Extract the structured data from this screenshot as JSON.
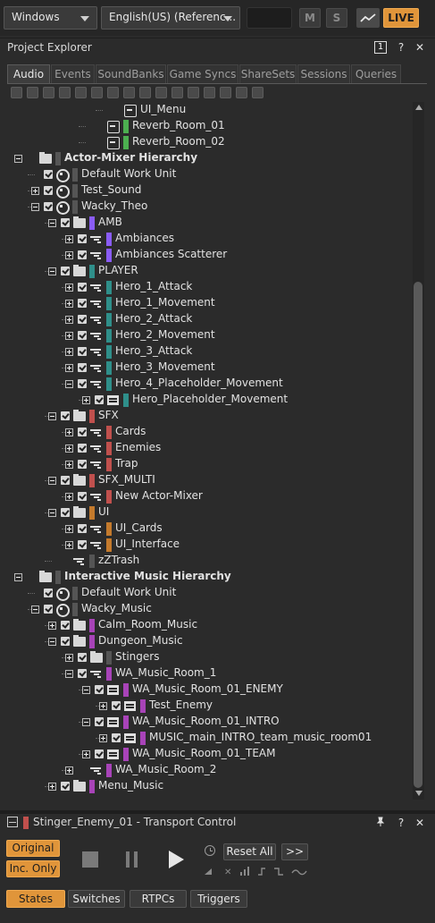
{
  "toolbar": {
    "platform": "Windows",
    "language": "English(US) (Referenc...",
    "mute": "M",
    "solo": "S",
    "live": "LIVE",
    "accent": "#e0953a"
  },
  "explorer": {
    "title": "Project Explorer",
    "badge": "1",
    "tabs": [
      "Audio",
      "Events",
      "SoundBanks",
      "Game Syncs",
      "ShareSets",
      "Sessions",
      "Queries"
    ],
    "active_tab": "Audio"
  },
  "tree": [
    {
      "label": "UI_Menu",
      "icon": "bus-icon",
      "level": 5,
      "exp": "",
      "cb": false,
      "bold": false,
      "color": ""
    },
    {
      "label": "Reverb_Room_01",
      "icon": "aux-bus-icon",
      "level": 4,
      "exp": "",
      "cb": false,
      "bold": false,
      "color": "#4caf50"
    },
    {
      "label": "Reverb_Room_02",
      "icon": "aux-bus-icon",
      "level": 4,
      "exp": "",
      "cb": false,
      "bold": false,
      "color": "#4caf50"
    },
    {
      "label": "Actor-Mixer Hierarchy",
      "icon": "folder-icon",
      "level": 0,
      "exp": "minus",
      "cb": false,
      "bold": true,
      "color": "#555555"
    },
    {
      "label": "Default Work Unit",
      "icon": "work-unit-icon",
      "level": 1,
      "exp": "",
      "cb": true,
      "bold": false,
      "color": "#555555"
    },
    {
      "label": "Test_Sound",
      "icon": "work-unit-icon",
      "level": 1,
      "exp": "plus",
      "cb": true,
      "bold": false,
      "color": "#555555"
    },
    {
      "label": "Wacky_Theo",
      "icon": "work-unit-icon",
      "level": 1,
      "exp": "minus",
      "cb": true,
      "bold": false,
      "color": "#555555"
    },
    {
      "label": "AMB",
      "icon": "folder-icon",
      "level": 2,
      "exp": "minus",
      "cb": true,
      "bold": false,
      "color": "#8a5cf6"
    },
    {
      "label": "Ambiances",
      "icon": "actor-mixer-icon",
      "level": 3,
      "exp": "plus",
      "cb": true,
      "bold": false,
      "color": "#8a5cf6"
    },
    {
      "label": "Ambiances Scatterer",
      "icon": "actor-mixer-icon",
      "level": 3,
      "exp": "plus",
      "cb": true,
      "bold": false,
      "color": "#8a5cf6"
    },
    {
      "label": "PLAYER",
      "icon": "folder-icon",
      "level": 2,
      "exp": "minus",
      "cb": true,
      "bold": false,
      "color": "#2f8f8a"
    },
    {
      "label": "Hero_1_Attack",
      "icon": "actor-mixer-icon",
      "level": 3,
      "exp": "plus",
      "cb": true,
      "bold": false,
      "color": "#2f8f8a"
    },
    {
      "label": "Hero_1_Movement",
      "icon": "actor-mixer-icon",
      "level": 3,
      "exp": "plus",
      "cb": true,
      "bold": false,
      "color": "#2f8f8a"
    },
    {
      "label": "Hero_2_Attack",
      "icon": "actor-mixer-icon",
      "level": 3,
      "exp": "plus",
      "cb": true,
      "bold": false,
      "color": "#2f8f8a"
    },
    {
      "label": "Hero_2_Movement",
      "icon": "actor-mixer-icon",
      "level": 3,
      "exp": "plus",
      "cb": true,
      "bold": false,
      "color": "#2f8f8a"
    },
    {
      "label": "Hero_3_Attack",
      "icon": "actor-mixer-icon",
      "level": 3,
      "exp": "plus",
      "cb": true,
      "bold": false,
      "color": "#2f8f8a"
    },
    {
      "label": "Hero_3_Movement",
      "icon": "actor-mixer-icon",
      "level": 3,
      "exp": "plus",
      "cb": true,
      "bold": false,
      "color": "#2f8f8a"
    },
    {
      "label": "Hero_4_Placeholder_Movement",
      "icon": "actor-mixer-icon",
      "level": 3,
      "exp": "minus",
      "cb": true,
      "bold": false,
      "color": "#2f8f8a"
    },
    {
      "label": "Hero_Placeholder_Movement",
      "icon": "container-icon",
      "level": 4,
      "exp": "plus",
      "cb": true,
      "bold": false,
      "color": "#2f8f8a"
    },
    {
      "label": "SFX",
      "icon": "folder-icon",
      "level": 2,
      "exp": "minus",
      "cb": true,
      "bold": false,
      "color": "#c0504d"
    },
    {
      "label": "Cards",
      "icon": "actor-mixer-icon",
      "level": 3,
      "exp": "plus",
      "cb": true,
      "bold": false,
      "color": "#c0504d"
    },
    {
      "label": "Enemies",
      "icon": "actor-mixer-icon",
      "level": 3,
      "exp": "plus",
      "cb": true,
      "bold": false,
      "color": "#c0504d"
    },
    {
      "label": "Trap",
      "icon": "actor-mixer-icon",
      "level": 3,
      "exp": "plus",
      "cb": true,
      "bold": false,
      "color": "#c0504d"
    },
    {
      "label": "SFX_MULTI",
      "icon": "folder-icon",
      "level": 2,
      "exp": "minus",
      "cb": true,
      "bold": false,
      "color": "#c0504d"
    },
    {
      "label": "New Actor-Mixer",
      "icon": "actor-mixer-icon",
      "level": 3,
      "exp": "plus",
      "cb": true,
      "bold": false,
      "color": "#c0504d"
    },
    {
      "label": "UI",
      "icon": "folder-icon",
      "level": 2,
      "exp": "minus",
      "cb": true,
      "bold": false,
      "color": "#c47a2c"
    },
    {
      "label": "UI_Cards",
      "icon": "actor-mixer-icon",
      "level": 3,
      "exp": "plus",
      "cb": true,
      "bold": false,
      "color": "#c47a2c"
    },
    {
      "label": "UI_Interface",
      "icon": "actor-mixer-icon",
      "level": 3,
      "exp": "plus",
      "cb": true,
      "bold": false,
      "color": "#c47a2c"
    },
    {
      "label": "zZTrash",
      "icon": "actor-mixer-icon",
      "level": 2,
      "exp": "",
      "cb": false,
      "bold": false,
      "color": "#555555"
    },
    {
      "label": "Interactive Music Hierarchy",
      "icon": "folder-icon",
      "level": 0,
      "exp": "minus",
      "cb": false,
      "bold": true,
      "color": "#555555"
    },
    {
      "label": "Default Work Unit",
      "icon": "work-unit-icon",
      "level": 1,
      "exp": "",
      "cb": true,
      "bold": false,
      "color": "#555555"
    },
    {
      "label": "Wacky_Music",
      "icon": "work-unit-icon",
      "level": 1,
      "exp": "minus",
      "cb": true,
      "bold": false,
      "color": "#555555"
    },
    {
      "label": "Calm_Room_Music",
      "icon": "folder-icon",
      "level": 2,
      "exp": "plus",
      "cb": true,
      "bold": false,
      "color": "#a843b8"
    },
    {
      "label": "Dungeon_Music",
      "icon": "folder-icon",
      "level": 2,
      "exp": "minus",
      "cb": true,
      "bold": false,
      "color": "#a843b8"
    },
    {
      "label": "Stingers",
      "icon": "folder-icon",
      "level": 3,
      "exp": "plus",
      "cb": true,
      "bold": false,
      "color": "#555555"
    },
    {
      "label": "WA_Music_Room_1",
      "icon": "music-switch-icon",
      "level": 3,
      "exp": "minus",
      "cb": true,
      "bold": false,
      "color": "#a843b8"
    },
    {
      "label": "WA_Music_Room_01_ENEMY",
      "icon": "playlist-icon",
      "level": 4,
      "exp": "minus",
      "cb": true,
      "bold": false,
      "color": "#a843b8"
    },
    {
      "label": "Test_Enemy",
      "icon": "music-segment-icon",
      "level": 5,
      "exp": "plus",
      "cb": true,
      "bold": false,
      "color": "#a843b8"
    },
    {
      "label": "WA_Music_Room_01_INTRO",
      "icon": "playlist-icon",
      "level": 4,
      "exp": "minus",
      "cb": true,
      "bold": false,
      "color": "#a843b8"
    },
    {
      "label": "MUSIC_main_INTRO_team_music_room01",
      "icon": "music-segment-icon",
      "level": 5,
      "exp": "plus",
      "cb": true,
      "bold": false,
      "color": "#a843b8"
    },
    {
      "label": "WA_Music_Room_01_TEAM",
      "icon": "playlist-icon",
      "level": 4,
      "exp": "plus",
      "cb": true,
      "bold": false,
      "color": "#a843b8"
    },
    {
      "label": "WA_Music_Room_2",
      "icon": "music-switch-icon",
      "level": 3,
      "exp": "plus",
      "cb": false,
      "bold": false,
      "color": "#a843b8"
    },
    {
      "label": "Menu_Music",
      "icon": "folder-icon",
      "level": 2,
      "exp": "plus",
      "cb": true,
      "bold": false,
      "color": "#a843b8"
    }
  ],
  "transport": {
    "title": "Stinger_Enemy_01 - Transport Control",
    "title_color": "#c0504d",
    "original": "Original",
    "inc_only": "Inc. Only",
    "reset_all": "Reset All",
    "more": ">>",
    "tabs": [
      "States",
      "Switches",
      "RTPCs",
      "Triggers"
    ],
    "active_tab": "States"
  }
}
